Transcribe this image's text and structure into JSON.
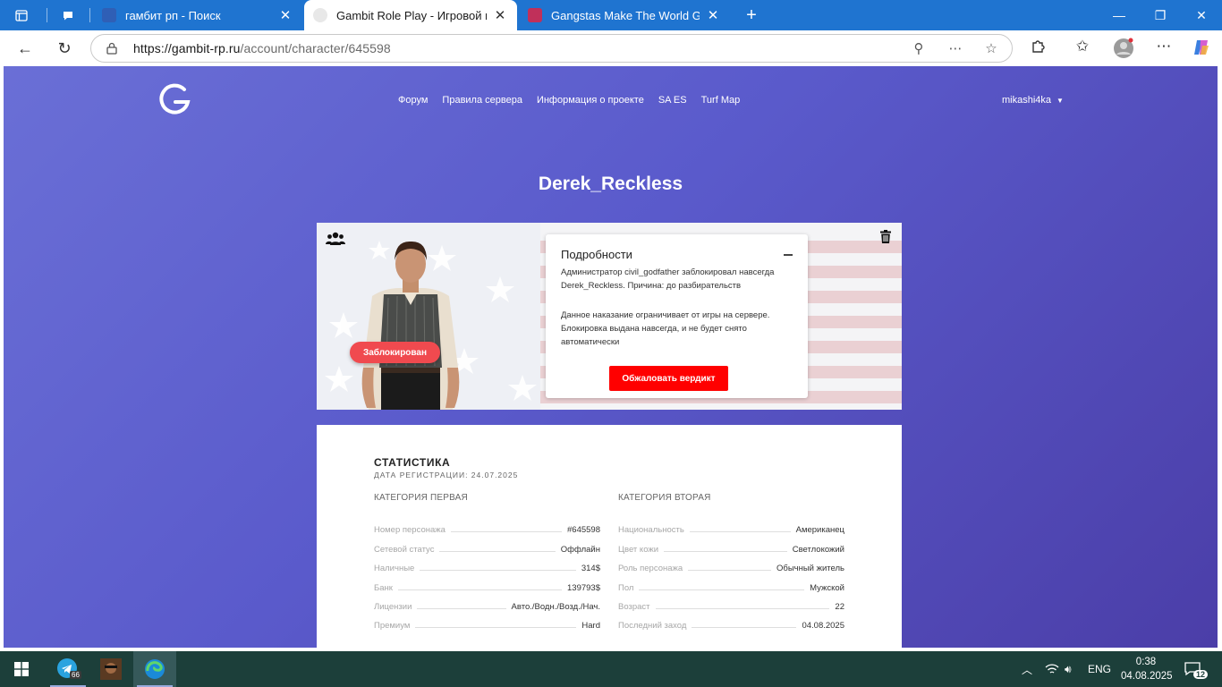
{
  "browser": {
    "tabs": [
      {
        "label": "гамбит рп - Поиск",
        "active": false
      },
      {
        "label": "Gambit Role Play - Игровой проф",
        "active": true
      },
      {
        "label": "Gangstas Make The World Go Ro",
        "active": false
      }
    ],
    "url_host": "https://gambit-rp.ru",
    "url_path": "/account/character/645598"
  },
  "site": {
    "nav": [
      "Форум",
      "Правила сервера",
      "Информация о проекте",
      "SA ES",
      "Turf Map"
    ],
    "username": "mikashi4ka"
  },
  "character": {
    "name": "Derek_Reckless",
    "status_badge": "Заблокирован"
  },
  "details": {
    "title": "Подробности",
    "text1": "Администратор civil_godfather заблокировал навсегда Derek_Reckless. Причина: до разбирательств",
    "text2": "Данное наказание ограничивает от игры на сервере. Блокировка выдана навсегда, и не будет снято автоматически",
    "appeal_button": "Обжаловать вердикт"
  },
  "stats": {
    "title": "СТАТИСТИКА",
    "registration": "ДАТА РЕГИСТРАЦИИ: 24.07.2025",
    "category1": {
      "heading": "КАТЕГОРИЯ ПЕРВАЯ",
      "rows": [
        {
          "label": "Номер персонажа",
          "value": "#645598"
        },
        {
          "label": "Сетевой статус",
          "value": "Оффлайн"
        },
        {
          "label": "Наличные",
          "value": "314$"
        },
        {
          "label": "Банк",
          "value": "139793$"
        },
        {
          "label": "Лицензии",
          "value": "Авто./Водн./Возд./Нач."
        },
        {
          "label": "Премиум",
          "value": "Hard"
        }
      ]
    },
    "category2": {
      "heading": "КАТЕГОРИЯ ВТОРАЯ",
      "rows": [
        {
          "label": "Национальность",
          "value": "Американец"
        },
        {
          "label": "Цвет кожи",
          "value": "Светлокожий"
        },
        {
          "label": "Роль персонажа",
          "value": "Обычный житель"
        },
        {
          "label": "Пол",
          "value": "Мужской"
        },
        {
          "label": "Возраст",
          "value": "22"
        },
        {
          "label": "Последний заход",
          "value": "04.08.2025"
        }
      ]
    }
  },
  "taskbar": {
    "telegram_badge": "66",
    "language": "ENG",
    "time": "0:38",
    "date": "04.08.2025",
    "notifications": "12"
  },
  "colors": {
    "page_gradient_start": "#6a6fd6",
    "page_gradient_end": "#4b3ea8",
    "appeal_button": "#ff0000",
    "blocked_badge": "#f04a4f",
    "browser_tabbar": "#1f74d0",
    "taskbar": "#1c3f3a"
  }
}
